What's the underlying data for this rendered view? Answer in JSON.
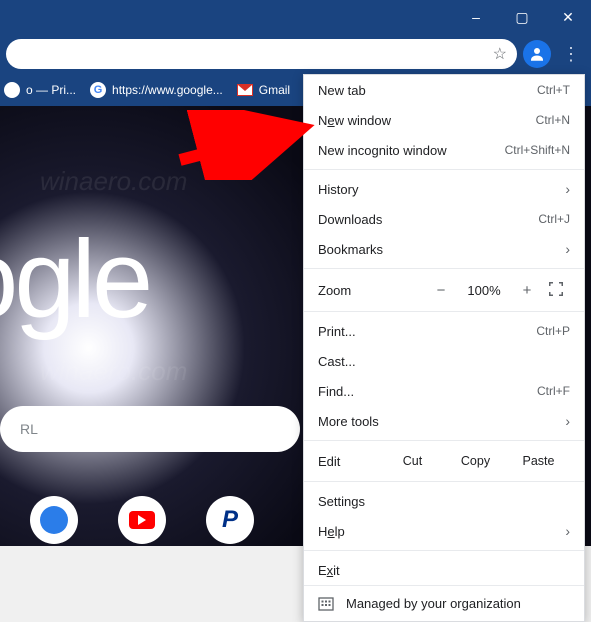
{
  "window": {
    "minimize": "–",
    "maximize": "▢",
    "close": "✕"
  },
  "toolbar": {
    "star": "☆",
    "kebab": "⋮"
  },
  "bookmarks": {
    "item1": "o — Pri...",
    "item2": "https://www.google...",
    "item3": "Gmail"
  },
  "page": {
    "logo": "oogle",
    "search_placeholder": "RL",
    "watermark": "winaero.com"
  },
  "menu": {
    "new_tab": "New tab",
    "new_tab_accel": "Ctrl+T",
    "new_window_pre": "N",
    "new_window_u": "e",
    "new_window_post": "w window",
    "new_window_accel": "Ctrl+N",
    "incognito": "New incognito window",
    "incognito_accel": "Ctrl+Shift+N",
    "history": "History",
    "downloads": "Downloads",
    "downloads_accel": "Ctrl+J",
    "bookmarks": "Bookmarks",
    "zoom": "Zoom",
    "zoom_minus": "−",
    "zoom_val": "100%",
    "zoom_plus": "+",
    "print": "Print...",
    "print_accel": "Ctrl+P",
    "cast": "Cast...",
    "find": "Find...",
    "find_accel": "Ctrl+F",
    "more_tools": "More tools",
    "edit": "Edit",
    "cut": "Cut",
    "copy": "Copy",
    "paste": "Paste",
    "settings": "Settings",
    "help_pre": "H",
    "help_u": "e",
    "help_post": "lp",
    "exit_pre": "E",
    "exit_u": "x",
    "exit_post": "it",
    "managed": "Managed by your organization"
  }
}
